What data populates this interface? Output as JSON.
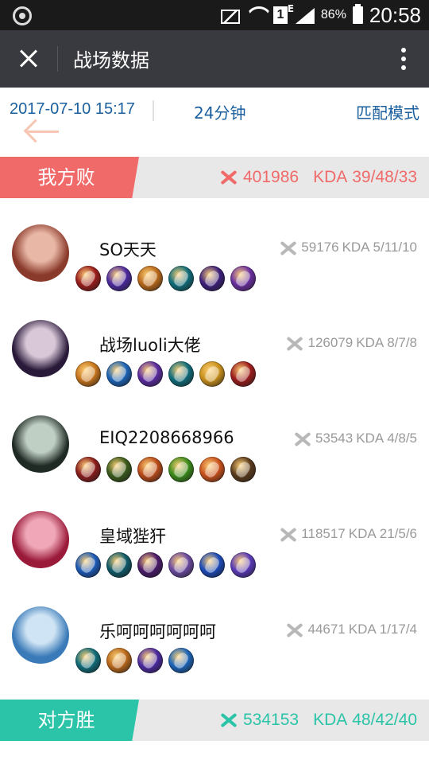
{
  "status_bar": {
    "battery": "86%",
    "time": "20:58",
    "sim_label": "1",
    "network_type": "E"
  },
  "header": {
    "title": "战场数据",
    "close_icon": "close-icon",
    "more_icon": "more-vertical-icon"
  },
  "match": {
    "datetime": "2017-07-10 15:17",
    "duration": "24分钟",
    "mode": "匹配模式"
  },
  "teams": [
    {
      "result": "我方败",
      "score": "401986",
      "kda_label": "KDA",
      "kda": "39/48/33",
      "tag_color": "#f06a6a",
      "stats_color": "#f06a6a",
      "players": [
        {
          "name": "SO天天",
          "score": "59176",
          "kda_label": "KDA",
          "kda": "5/11/10",
          "avatar_colors": [
            "#8a3a2a",
            "#e9b7a6"
          ],
          "items": [
            "#9b1c1c",
            "#4b2aa0",
            "#b8681a",
            "#0f6c7a",
            "#3c1f7a",
            "#6a2fa0"
          ]
        },
        {
          "name": "战场luoli大佬",
          "score": "126079",
          "kda_label": "KDA",
          "kda": "8/7/8",
          "avatar_colors": [
            "#2a1a3a",
            "#d9c8d8"
          ],
          "items": [
            "#c6741c",
            "#1c64b8",
            "#5a2aa0",
            "#0f6c7a",
            "#c8901c",
            "#9b1c1c"
          ]
        },
        {
          "name": "EIQ2208668966",
          "score": "53543",
          "kda_label": "KDA",
          "kda": "4/8/5",
          "avatar_colors": [
            "#1f2a24",
            "#bfcfc4"
          ],
          "items": [
            "#8a1c1c",
            "#3a5a1c",
            "#b84a1a",
            "#3a8a1a",
            "#c8501c",
            "#5a3a1c"
          ]
        },
        {
          "name": "皇域狴犴",
          "score": "118517",
          "kda_label": "KDA",
          "kda": "21/5/6",
          "avatar_colors": [
            "#9a1a3a",
            "#f0a8b8"
          ],
          "items": [
            "#1c5ab8",
            "#0f5a6a",
            "#4a1a6a",
            "#6a4aa0",
            "#1c4ab8",
            "#5a3ab8"
          ]
        },
        {
          "name": "乐呵呵呵呵呵呵",
          "score": "44671",
          "kda_label": "KDA",
          "kda": "1/17/4",
          "avatar_colors": [
            "#3a7ab8",
            "#cfe4f4"
          ],
          "items": [
            "#0f6c7a",
            "#b8681a",
            "#4b2aa0",
            "#1c64b8"
          ]
        }
      ]
    },
    {
      "result": "对方胜",
      "score": "534153",
      "kda_label": "KDA",
      "kda": "48/42/40",
      "tag_color": "#2cc4a8",
      "stats_color": "#2cc4a8"
    }
  ]
}
